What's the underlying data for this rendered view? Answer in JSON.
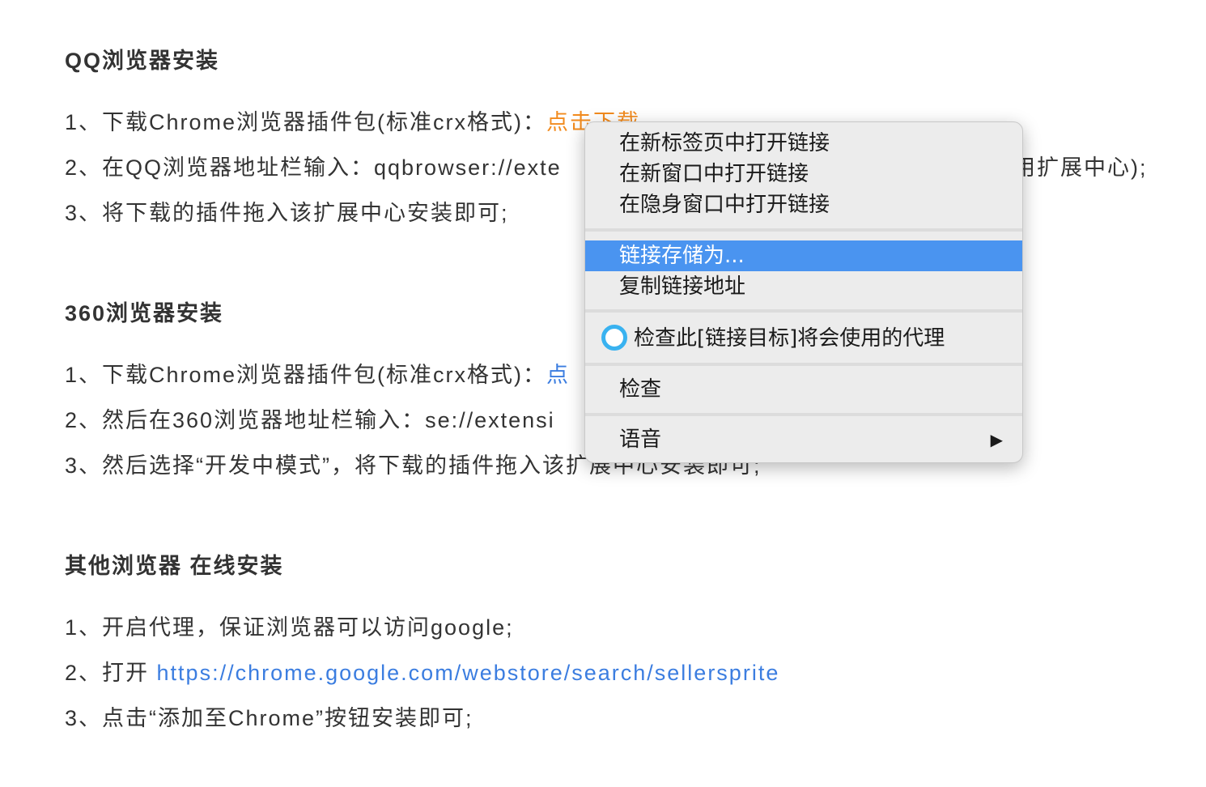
{
  "sections": [
    {
      "title": "QQ浏览器安装",
      "steps": [
        {
          "text": "1、下载Chrome浏览器插件包(标准crx格式)：",
          "link": "点击下载"
        },
        {
          "text": "2、在QQ浏览器地址栏输入：qqbrowser://exte",
          "tail": "用扩展中心);"
        },
        {
          "text": "3、将下载的插件拖入该扩展中心安装即可;"
        }
      ]
    },
    {
      "title": "360浏览器安装",
      "steps": [
        {
          "text": "1、下载Chrome浏览器插件包(标准crx格式)：",
          "link": "点"
        },
        {
          "text": "2、然后在360浏览器地址栏输入：se://extensi"
        },
        {
          "text": "3、然后选择“开发中模式”，将下载的插件拖入该扩展中心安装即可;"
        }
      ]
    },
    {
      "title": "其他浏览器 在线安装",
      "steps": [
        {
          "text": "1、开启代理，保证浏览器可以访问google;"
        },
        {
          "text": "2、打开 ",
          "link": "https://chrome.google.com/webstore/search/sellersprite"
        },
        {
          "text": "3、点击“添加至Chrome”按钮安装即可;"
        }
      ]
    }
  ],
  "context_menu": {
    "items": {
      "open_new_tab": "在新标签页中打开链接",
      "open_new_window": "在新窗口中打开链接",
      "open_incognito": "在隐身窗口中打开链接",
      "save_link_as": "链接存储为...",
      "copy_link_address": "复制链接地址",
      "proxy_check": "检查此[链接目标]将会使用的代理",
      "inspect": "检查",
      "speech": "语音"
    },
    "highlighted_item": "save_link_as",
    "submenu_arrow": "▶",
    "colors": {
      "highlight": "#4a94f0",
      "background": "#ececec",
      "extension_icon": "#39b2f0"
    }
  },
  "colors": {
    "text": "#333333",
    "link_orange": "#f28b1e",
    "link_blue": "#3b7de0"
  }
}
